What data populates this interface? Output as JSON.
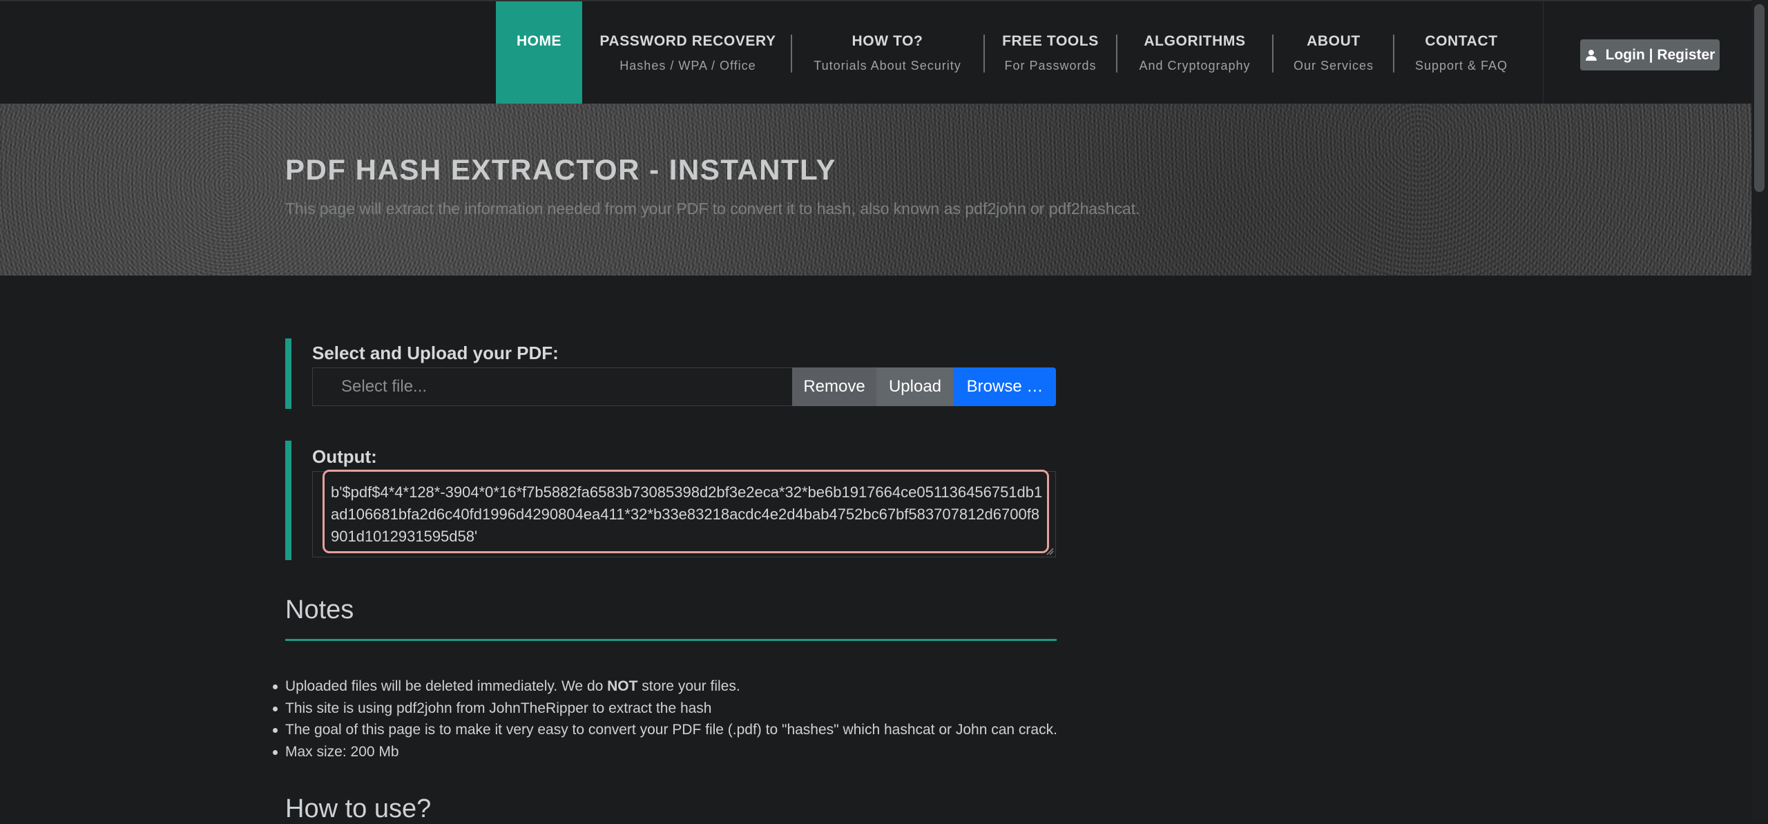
{
  "nav": {
    "home": "HOME",
    "items": [
      {
        "title": "PASSWORD RECOVERY",
        "sub": "Hashes / WPA / Office"
      },
      {
        "title": "HOW TO?",
        "sub": "Tutorials About Security"
      },
      {
        "title": "FREE TOOLS",
        "sub": "For Passwords"
      },
      {
        "title": "ALGORITHMS",
        "sub": "And Cryptography"
      },
      {
        "title": "ABOUT",
        "sub": "Our Services"
      },
      {
        "title": "CONTACT",
        "sub": "Support & FAQ"
      }
    ],
    "login": "Login | Register"
  },
  "hero": {
    "title": "PDF HASH EXTRACTOR - INSTANTLY",
    "subtitle": "This page will extract the information needed from your PDF to convert it to hash, also known as pdf2john or pdf2hashcat."
  },
  "upload": {
    "label": "Select and Upload your PDF:",
    "placeholder": "Select  file...",
    "remove": "Remove",
    "upload": "Upload",
    "browse": "Browse …"
  },
  "output": {
    "label": "Output:",
    "value": "b'$pdf$4*4*128*-3904*0*16*f7b5882fa6583b73085398d2bf3e2eca*32*be6b1917664ce051136456751db1ad106681bfa2d6c40fd1996d4290804ea411*32*b33e83218acdc4e2d4bab4752bc67bf583707812d6700f8901d1012931595d58'"
  },
  "notes": {
    "title": "Notes",
    "items": [
      {
        "pre": "Uploaded files will be deleted immediately. We do ",
        "bold": "NOT",
        "post": " store your files."
      },
      {
        "pre": "This site is using pdf2john from JohnTheRipper to extract the hash",
        "bold": "",
        "post": ""
      },
      {
        "pre": "The goal of this page is to make it very easy to convert your PDF file (.pdf) to \"hashes\" which hashcat or John can crack.",
        "bold": "",
        "post": ""
      },
      {
        "pre": "Max size: 200 Mb",
        "bold": "",
        "post": ""
      }
    ]
  },
  "howto": {
    "title": "How to use?"
  },
  "colors": {
    "accent": "#1b9a85",
    "browse": "#0d6efd",
    "background": "#1b1c1e",
    "output_highlight": "#e7a0a0"
  },
  "icons": {
    "login": "user-icon"
  }
}
